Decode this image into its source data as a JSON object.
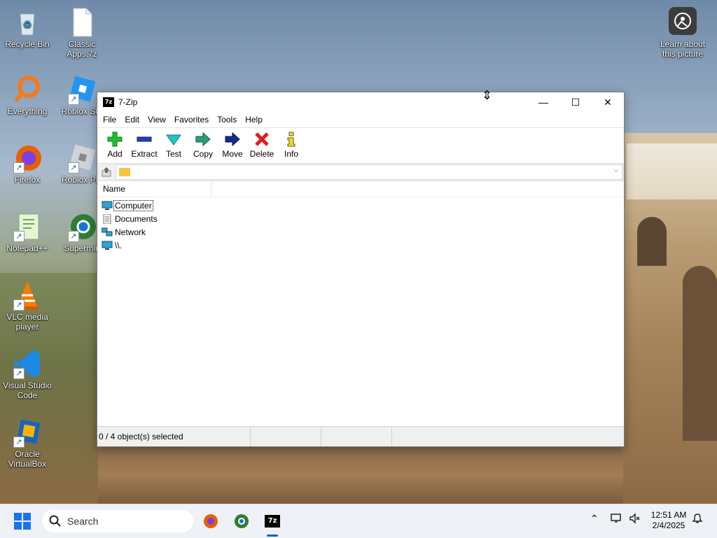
{
  "desktop": {
    "icons": [
      {
        "label": "Recycle Bin"
      },
      {
        "label": "Classic Apps.7z"
      },
      {
        "label": "Everything"
      },
      {
        "label": "Roblox Stu"
      },
      {
        "label": "Firefox"
      },
      {
        "label": "Roblox Pla"
      },
      {
        "label": "Notepad++"
      },
      {
        "label": "Supermiu"
      },
      {
        "label": "VLC media player"
      },
      {
        "label": "Visual Studio Code"
      },
      {
        "label": "Oracle VirtualBox"
      }
    ],
    "learn_label": "Learn about this picture"
  },
  "window": {
    "app_icon_text": "7z",
    "title": "7-Zip",
    "controls": {
      "minimize": "—",
      "maximize": "☐",
      "close": "✕"
    }
  },
  "menu": [
    "File",
    "Edit",
    "View",
    "Favorites",
    "Tools",
    "Help"
  ],
  "toolbar": [
    "Add",
    "Extract",
    "Test",
    "Copy",
    "Move",
    "Delete",
    "Info"
  ],
  "address": {
    "value": ""
  },
  "list": {
    "columns": [
      "Name"
    ],
    "items": [
      "Computer",
      "Documents",
      "Network",
      "\\\\."
    ]
  },
  "status": {
    "selection": "0 / 4 object(s) selected"
  },
  "taskbar": {
    "search_label": "Search",
    "time": "12:51 AM",
    "date": "2/4/2025",
    "accent": "#0067c0"
  }
}
